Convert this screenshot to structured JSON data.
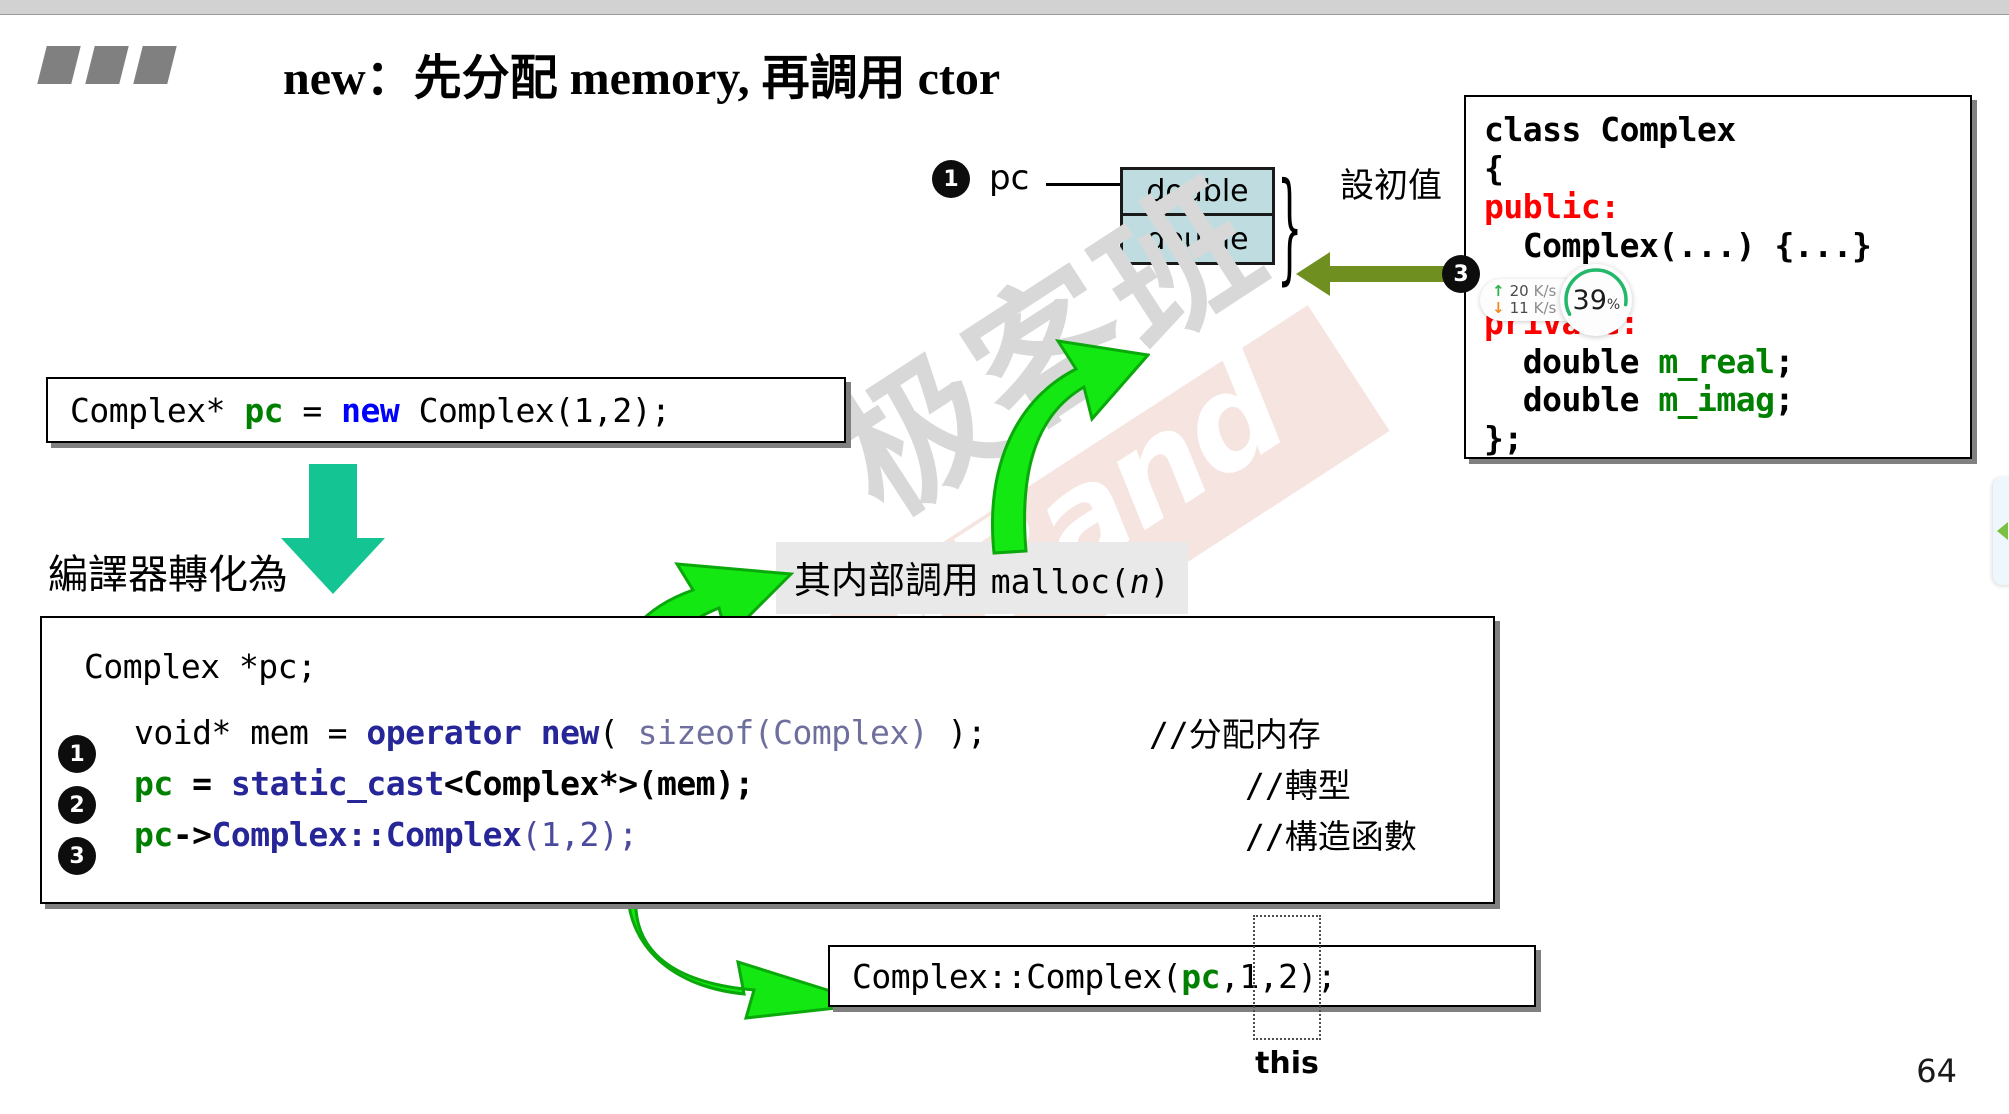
{
  "slide": {
    "title": "new：先分配 memory, 再調用 ctor",
    "page_number": "64",
    "bullet_count": 3
  },
  "watermark": {
    "latin": "GeekBand",
    "cjk": "极客班",
    "band_color": "#f4dfdc",
    "cjk_color": "#d8d8d8"
  },
  "memory_diagram": {
    "step_badge": "1",
    "pointer_label": "pc",
    "cells": [
      "double",
      "double"
    ],
    "cell_fill": "#bfdde0",
    "brace": "}",
    "init_label": "設初值",
    "init_arrow_color": "#6f9021",
    "init_step_badge": "3"
  },
  "source_box": {
    "segments": [
      {
        "text": "Complex* ",
        "style": "plain"
      },
      {
        "text": "pc",
        "style": "id-pc"
      },
      {
        "text": " = ",
        "style": "plain"
      },
      {
        "text": "new",
        "style": "kw-new"
      },
      {
        "text": " Complex(1,2);",
        "style": "plain"
      }
    ],
    "plain_text": "Complex* pc = new Complex(1,2);"
  },
  "transform": {
    "label": "編譯器轉化為",
    "arrow_color": "#14c492"
  },
  "malloc_caption": {
    "prefix": "其内部調用 ",
    "call_open": "malloc(",
    "call_arg": "n",
    "call_close": ")",
    "background": "#e9e9e9"
  },
  "expanded_box": {
    "declaration": "Complex *pc;",
    "lines": [
      {
        "badge": "1",
        "segments": [
          {
            "text": "void* mem = ",
            "style": "plain"
          },
          {
            "text": "operator new",
            "style": "navy"
          },
          {
            "text": "( ",
            "style": "plain"
          },
          {
            "text": "sizeof(Complex)",
            "style": "gray-code"
          },
          {
            "text": " );",
            "style": "plain"
          }
        ],
        "comment": "//分配内存"
      },
      {
        "badge": "2",
        "segments": [
          {
            "text": "pc",
            "style": "id-pc bold"
          },
          {
            "text": " = ",
            "style": "bold"
          },
          {
            "text": "static_cast",
            "style": "navy"
          },
          {
            "text": "<Complex*>(mem);",
            "style": "bold"
          }
        ],
        "comment": "//轉型"
      },
      {
        "badge": "3",
        "segments": [
          {
            "text": "pc",
            "style": "id-pc bold"
          },
          {
            "text": "->",
            "style": "bold"
          },
          {
            "text": "Complex::Complex",
            "style": "navy"
          },
          {
            "text": "(1,2);",
            "style": "navy-light"
          }
        ],
        "comment": "//構造函數"
      }
    ]
  },
  "ctor_box": {
    "segments": [
      {
        "text": "Complex::Complex(",
        "style": "plain"
      },
      {
        "text": "pc",
        "style": "id-pc"
      },
      {
        "text": ",1,2);",
        "style": "plain"
      }
    ],
    "plain_text": "Complex::Complex(pc,1,2);",
    "this_label": "this"
  },
  "class_box": {
    "lines": [
      [
        {
          "text": "class Complex",
          "style": "plain"
        }
      ],
      [
        {
          "text": "{",
          "style": "plain"
        }
      ],
      [
        {
          "text": "public:",
          "style": "acc"
        }
      ],
      [
        {
          "text": "  Complex(...) {...}",
          "style": "plain"
        }
      ],
      [
        {
          "text": "  ...",
          "style": "plain"
        }
      ],
      [
        {
          "text": "private:",
          "style": "acc"
        }
      ],
      [
        {
          "text": "  double ",
          "style": "plain"
        },
        {
          "text": "m_real",
          "style": "mem"
        },
        {
          "text": ";",
          "style": "plain"
        }
      ],
      [
        {
          "text": "  double ",
          "style": "plain"
        },
        {
          "text": "m_imag",
          "style": "mem"
        },
        {
          "text": ";",
          "style": "plain"
        }
      ],
      [
        {
          "text": "};",
          "style": "plain"
        }
      ]
    ],
    "public_keyword": "public:",
    "private_keyword": "private:",
    "member_color": "#008000",
    "access_color": "#ff0000"
  },
  "overlay_widget": {
    "upload": {
      "arrow": "↑",
      "value": "20",
      "unit": "K/s",
      "color": "#2eb24c"
    },
    "download": {
      "arrow": "↓",
      "value": "11",
      "unit": "K/s",
      "color": "#f08a1e"
    },
    "progress": {
      "value": "39",
      "symbol": "%",
      "percent": 39,
      "ring_color": "#21b86a"
    }
  }
}
